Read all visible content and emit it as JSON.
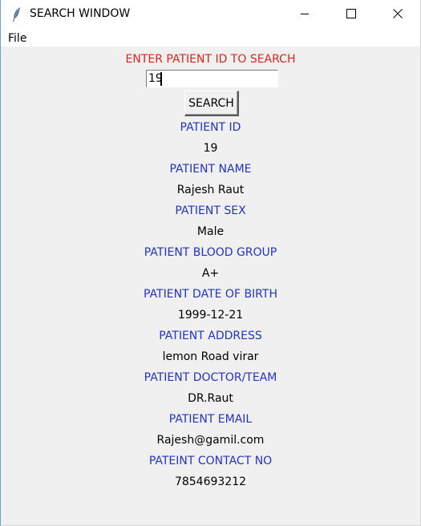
{
  "window": {
    "title": "SEARCH WINDOW",
    "icon": "feather-icon",
    "controls": [
      "minimize-icon",
      "maximize-icon",
      "close-icon"
    ]
  },
  "menu": {
    "items": [
      "File"
    ]
  },
  "search": {
    "prompt": "ENTER PATIENT ID TO SEARCH",
    "input_value": "19",
    "button_label": "SEARCH"
  },
  "fields": [
    {
      "label": "PATIENT ID",
      "value": "19"
    },
    {
      "label": "PATIENT NAME",
      "value": "Rajesh Raut"
    },
    {
      "label": "PATIENT SEX",
      "value": "Male"
    },
    {
      "label": "PATIENT BLOOD GROUP",
      "value": "A+"
    },
    {
      "label": "PATIENT DATE OF BIRTH",
      "value": "1999-12-21"
    },
    {
      "label": "PATIENT ADDRESS",
      "value": "lemon Road virar"
    },
    {
      "label": "PATIENT DOCTOR/TEAM",
      "value": "DR.Raut"
    },
    {
      "label": "PATIENT EMAIL",
      "value": "Rajesh@gamil.com"
    },
    {
      "label": "PATEINT CONTACT NO",
      "value": "7854693212"
    }
  ],
  "colors": {
    "prompt": "#e0241b",
    "label": "#2233c8",
    "value": "#000000",
    "background": "#f0f0f0"
  }
}
